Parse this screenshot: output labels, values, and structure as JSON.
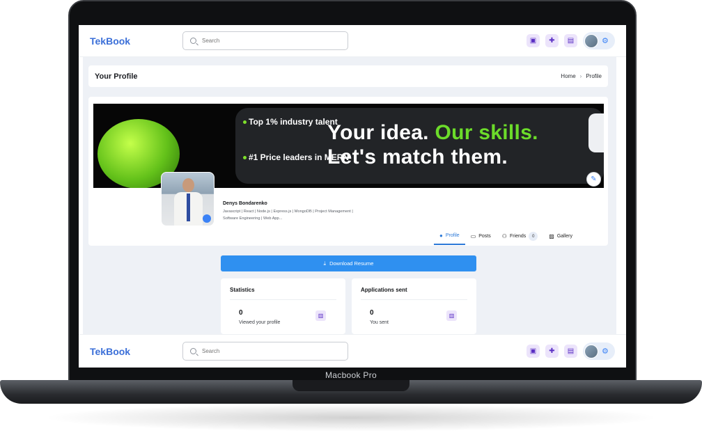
{
  "device": {
    "label": "Macbook Pro"
  },
  "topbar": {
    "logo": "TekBook",
    "search_placeholder": "Search",
    "icons": [
      "briefcase-icon",
      "add-person-icon",
      "chat-icon"
    ],
    "settings_icon": "gear-icon"
  },
  "header": {
    "title": "Your Profile",
    "breadcrumb": {
      "home": "Home",
      "separator": ">",
      "current": "Profile"
    }
  },
  "banner": {
    "bullet1": "Top 1% industry talent",
    "bullet2": "#1 Price leaders in MERN",
    "headline_line1_part1": "Your idea. ",
    "headline_line1_part2": "Our  skills.",
    "headline_line2": "Let's match them."
  },
  "profile": {
    "name": "Denys Bondarenko",
    "description": "Javascript | React | Node.js | Express.js | MongoDB | Project Management | Software Engineering | Web App..."
  },
  "tabs": [
    {
      "label": "Profile",
      "icon": "user-circle-icon"
    },
    {
      "label": "Posts",
      "icon": "inbox-icon"
    },
    {
      "label": "Friends",
      "icon": "people-icon",
      "count": "0"
    },
    {
      "label": "Gallery",
      "icon": "image-icon"
    }
  ],
  "resume_button": "Download Resume",
  "stats": [
    {
      "title": "Statistics",
      "value": "0",
      "label": "Viewed your profile"
    },
    {
      "title": "Applications sent",
      "value": "0",
      "label": "You sent"
    }
  ],
  "colors": {
    "brand": "#3b6fd8",
    "accent": "#2f90f0",
    "banner_green": "#6cdc2a"
  }
}
